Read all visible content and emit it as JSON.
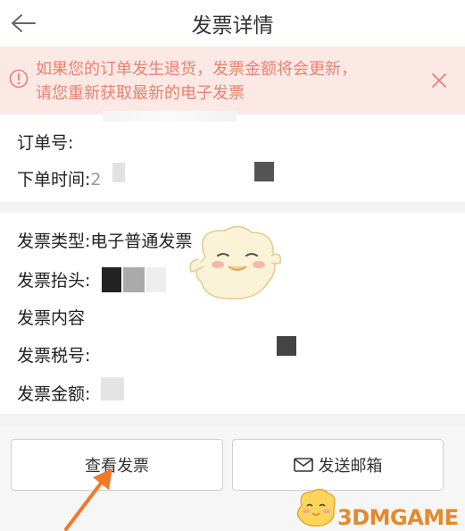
{
  "header": {
    "title": "发票详情",
    "back_icon": "back-arrow-icon"
  },
  "notice": {
    "text_line1": "如果您的订单发生退货，发票金额将会更新，",
    "text_line2": "请您重新获取最新的电子发票",
    "color": "#e9826f",
    "background": "#fce9e6"
  },
  "order": {
    "order_no_label": "订单号:",
    "order_time_label": "下单时间:",
    "order_time_value": "2"
  },
  "invoice": {
    "type_label": "发票类型:",
    "type_value": "电子普通发票",
    "header_label": "发票抬头:",
    "content_label": "发票内容",
    "tax_no_label": "发票税号:",
    "amount_label": "发票金额:"
  },
  "actions": {
    "view_label": "查看发票",
    "send_label": "发送邮箱"
  },
  "watermark": {
    "text": "3DMGAME",
    "color": "#e38a2c"
  },
  "annotation": {
    "arrow_color": "#f07a2a"
  }
}
